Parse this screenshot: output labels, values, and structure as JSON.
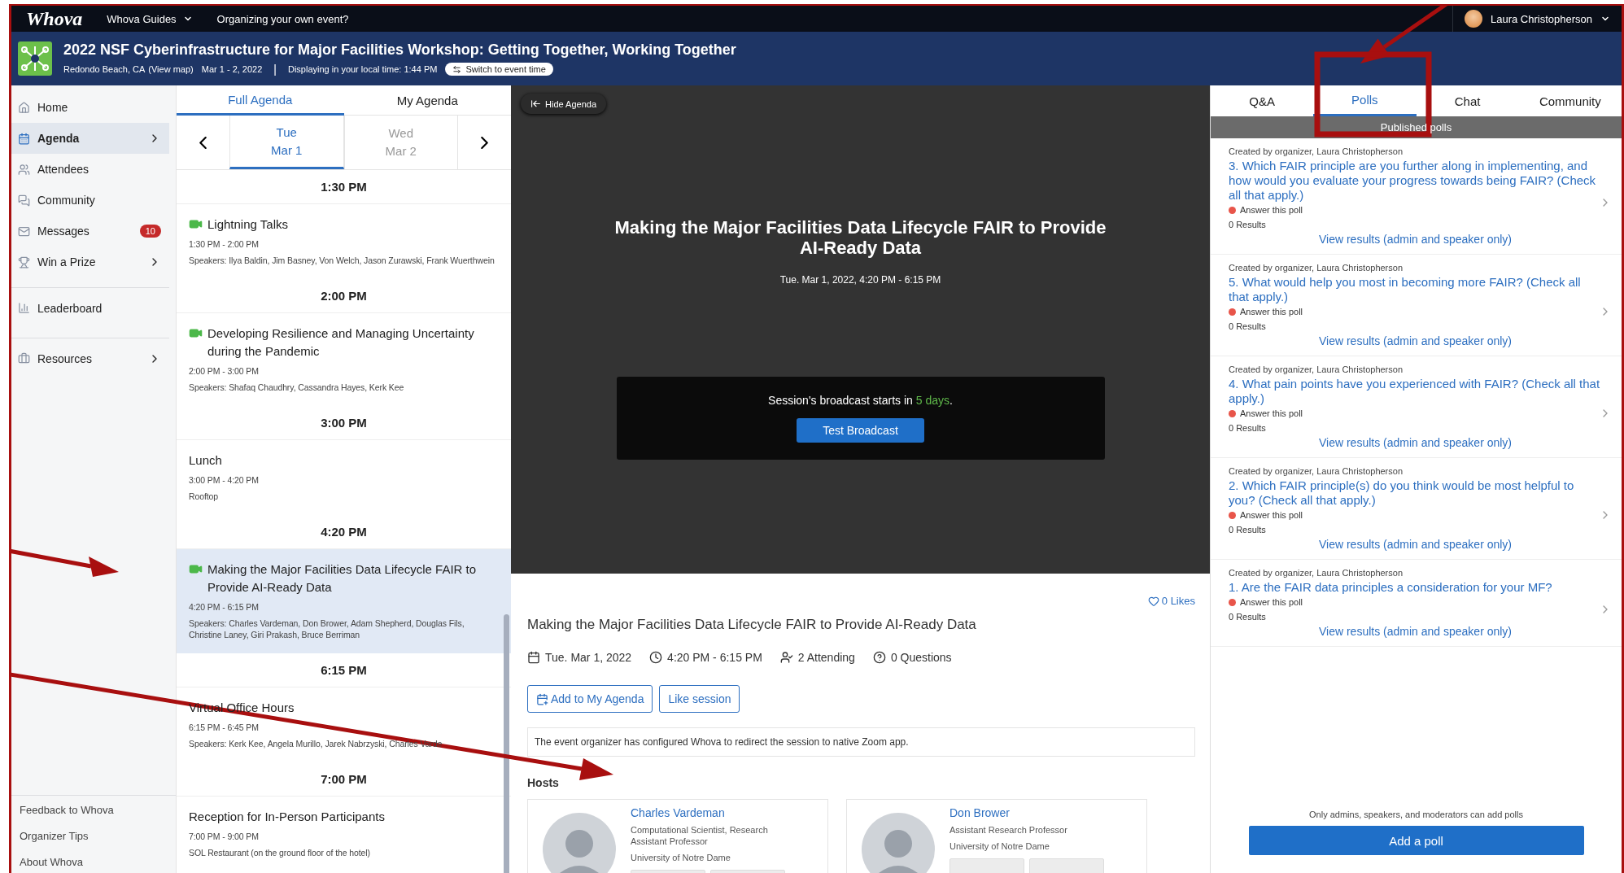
{
  "top_bar": {
    "logo": "Whova",
    "menu": [
      {
        "label": "Whova Guides",
        "dropdown": true
      },
      {
        "label": "Organizing your own event?",
        "dropdown": false
      }
    ],
    "user": {
      "name": "Laura Christopherson"
    }
  },
  "event": {
    "title": "2022 NSF Cyberinfrastructure for Major Facilities Workshop: Getting Together, Working Together",
    "location": "Redondo Beach, CA",
    "map_link": "(View map)",
    "dates": "Mar 1 - 2, 2022",
    "separator": "|",
    "local_time": "Displaying in your local time: 1:44 PM",
    "switch_button": "Switch to event time"
  },
  "sidebar": {
    "items": [
      {
        "label": "Home",
        "selected": false,
        "chevron": false
      },
      {
        "label": "Agenda",
        "selected": true,
        "chevron": true
      },
      {
        "label": "Attendees",
        "selected": false,
        "chevron": false
      },
      {
        "label": "Community",
        "selected": false,
        "chevron": false
      },
      {
        "label": "Messages",
        "selected": false,
        "chevron": false,
        "badge": "10"
      },
      {
        "label": "Win a Prize",
        "selected": false,
        "chevron": true
      },
      {
        "label": "Leaderboard",
        "selected": false,
        "chevron": false,
        "divider": true
      },
      {
        "label": "Resources",
        "selected": false,
        "chevron": true,
        "divider": true
      }
    ],
    "footer_links": [
      "Feedback to Whova",
      "Organizer Tips",
      "About Whova"
    ]
  },
  "agenda": {
    "tabs": [
      {
        "label": "Full Agenda",
        "selected": true
      },
      {
        "label": "My Agenda",
        "selected": false
      }
    ],
    "days": [
      {
        "weekday": "Tue",
        "date": "Mar 1",
        "selected": true
      },
      {
        "weekday": "Wed",
        "date": "Mar 2",
        "selected": false
      }
    ],
    "sections": [
      {
        "time": "1:30 PM",
        "sessions": [
          {
            "title": "Lightning Talks",
            "time": "1:30 PM - 2:00 PM",
            "details": "Speakers: Ilya Baldin, Jim Basney, Von Welch, Jason Zurawski, Frank Wuerthwein",
            "virtual": true,
            "selected": false
          }
        ]
      },
      {
        "time": "2:00 PM",
        "sessions": [
          {
            "title": "Developing Resilience and Managing Uncertainty during the Pandemic",
            "time": "2:00 PM - 3:00 PM",
            "details": "Speakers: Shafaq Chaudhry, Cassandra Hayes, Kerk Kee",
            "virtual": true,
            "selected": false
          }
        ]
      },
      {
        "time": "3:00 PM",
        "sessions": [
          {
            "title": "Lunch",
            "time": "3:00 PM - 4:20 PM",
            "details": "Rooftop",
            "virtual": false,
            "selected": false
          }
        ]
      },
      {
        "time": "4:20 PM",
        "sessions": [
          {
            "title": "Making the Major Facilities Data Lifecycle FAIR to Provide AI-Ready Data",
            "time": "4:20 PM - 6:15 PM",
            "details": "Speakers: Charles Vardeman, Don Brower, Adam Shepherd, Douglas Fils, Christine Laney, Giri Prakash, Bruce Berriman",
            "virtual": true,
            "selected": true
          }
        ]
      },
      {
        "time": "6:15 PM",
        "sessions": [
          {
            "title": "Virtual Office Hours",
            "time": "6:15 PM - 6:45 PM",
            "details": "Speakers: Kerk Kee, Angela Murillo, Jarek Nabrzyski, Charles Varde",
            "virtual": false,
            "selected": false
          }
        ]
      },
      {
        "time": "7:00 PM",
        "sessions": [
          {
            "title": "Reception for In-Person Participants",
            "time": "7:00 PM - 9:00 PM",
            "details": "SOL Restaurant (on the ground floor of the hotel)",
            "virtual": false,
            "selected": false
          }
        ]
      }
    ]
  },
  "stage": {
    "hide_button": "Hide Agenda",
    "title": "Making the Major Facilities Data Lifecycle FAIR to Provide AI-Ready Data",
    "datetime": "Tue. Mar 1, 2022, 4:20 PM - 6:15 PM",
    "broadcast": {
      "prefix": "Session's broadcast starts in",
      "highlight": "5 days",
      "suffix": "."
    },
    "test_button": "Test Broadcast"
  },
  "session": {
    "likes": "0 Likes",
    "title": "Making the Major Facilities Data Lifecycle FAIR to Provide AI-Ready Data",
    "meta": [
      {
        "kind": "date",
        "text": "Tue. Mar 1, 2022"
      },
      {
        "kind": "time",
        "text": "4:20 PM - 6:15 PM"
      },
      {
        "kind": "attending",
        "text": "2 Attending"
      },
      {
        "kind": "questions",
        "text": "0 Questions"
      }
    ],
    "buttons": [
      {
        "label": "Add to My Agenda",
        "icon": true
      },
      {
        "label": "Like session",
        "icon": false
      }
    ],
    "notice": "The event organizer has configured Whova to redirect the session to native Zoom app.",
    "hosts_heading": "Hosts",
    "hosts": [
      {
        "name": "Charles Vardeman",
        "role": "Computational Scientist, Research Assistant Professor",
        "org": "University of Notre Dame"
      },
      {
        "name": "Don Brower",
        "role": "Assistant Research Professor",
        "org": "University of Notre Dame"
      }
    ]
  },
  "polls_panel": {
    "tabs": [
      {
        "label": "Q&A",
        "selected": false
      },
      {
        "label": "Polls",
        "selected": true
      },
      {
        "label": "Chat",
        "selected": false
      },
      {
        "label": "Community",
        "selected": false
      }
    ],
    "subheader": "Published polls",
    "polls": [
      {
        "creator": "Created by organizer, Laura Christopherson",
        "question": "3. Which FAIR principle are you further along in implementing, and how would you evaluate your progress towards being FAIR? (Check all that apply.)",
        "status": "Answer this poll",
        "results": "0 Results",
        "link": "View results (admin and speaker only)"
      },
      {
        "creator": "Created by organizer, Laura Christopherson",
        "question": "5. What would help you most in becoming more FAIR? (Check all that apply.)",
        "status": "Answer this poll",
        "results": "0 Results",
        "link": "View results (admin and speaker only)"
      },
      {
        "creator": "Created by organizer, Laura Christopherson",
        "question": "4. What pain points have you experienced with FAIR? (Check all that apply.)",
        "status": "Answer this poll",
        "results": "0 Results",
        "link": "View results (admin and speaker only)"
      },
      {
        "creator": "Created by organizer, Laura Christopherson",
        "question": "2. Which FAIR principle(s) do you think would be most helpful to you? (Check all that apply.)",
        "status": "Answer this poll",
        "results": "0 Results",
        "link": "View results (admin and speaker only)"
      },
      {
        "creator": "Created by organizer, Laura Christopherson",
        "question": "1. Are the FAIR data principles a consideration for your MF?",
        "status": "Answer this poll",
        "results": "0 Results",
        "link": "View results (admin and speaker only)"
      }
    ],
    "footer_note": "Only admins, speakers, and moderators can add polls",
    "add_button": "Add a poll"
  }
}
